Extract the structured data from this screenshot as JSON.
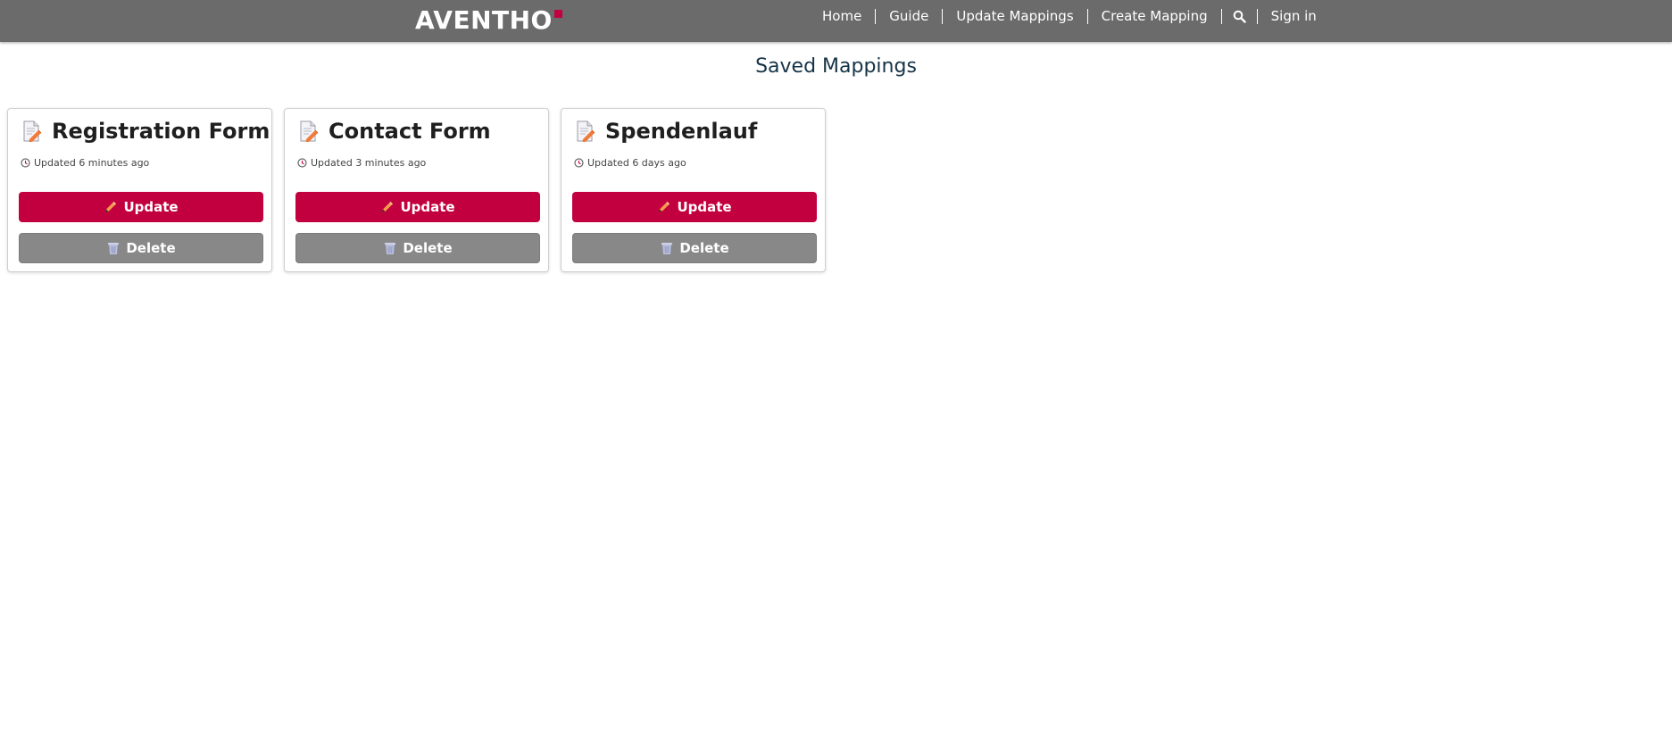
{
  "header": {
    "logo_text": "AVENTHO",
    "logo_mark_color": "#c3003f",
    "bar_color": "#6b6b6b",
    "nav": [
      {
        "label": "Home"
      },
      {
        "label": "Guide"
      },
      {
        "label": "Update Mappings"
      },
      {
        "label": "Create Mapping"
      }
    ],
    "search_icon": "search-icon",
    "signin_label": "Sign in"
  },
  "main": {
    "title": "Saved Mappings",
    "cards": [
      {
        "title": "Registration Form",
        "updated": "Updated 6 minutes ago",
        "update_label": "Update",
        "delete_label": "Delete"
      },
      {
        "title": "Contact Form",
        "updated": "Updated 3 minutes ago",
        "update_label": "Update",
        "delete_label": "Delete"
      },
      {
        "title": "Spendenlauf",
        "updated": "Updated 6 days ago",
        "update_label": "Update",
        "delete_label": "Delete"
      }
    ]
  },
  "colors": {
    "primary": "#c3003f",
    "secondary": "#888888",
    "title": "#163447"
  },
  "icons": {
    "card": "document-edit-icon",
    "meta": "clock-icon",
    "update": "pencil-icon",
    "delete": "trash-icon"
  }
}
